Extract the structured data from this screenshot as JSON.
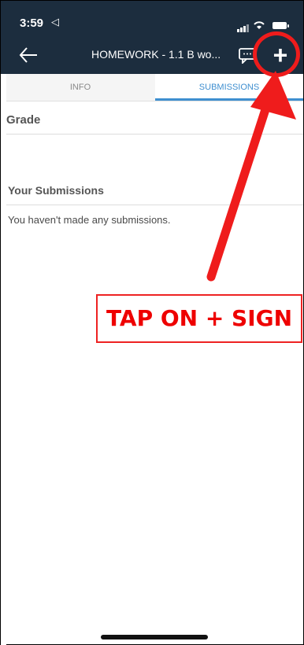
{
  "status_bar": {
    "time": "3:59",
    "location_glyph": "◁"
  },
  "nav": {
    "back_icon": "back-arrow-icon",
    "title": "HOMEWORK - 1.1 B wo...",
    "chat_icon": "chat-bubble-icon",
    "add_label": "+"
  },
  "tabs": [
    {
      "label": "INFO",
      "active": false
    },
    {
      "label": "SUBMISSIONS",
      "active": true
    }
  ],
  "grade": {
    "heading": "Grade"
  },
  "submissions": {
    "heading": "Your Submissions",
    "empty_message": "You haven't made any submissions."
  },
  "annotation": {
    "label": "TAP ON + SIGN",
    "color": "#ef1c1c"
  },
  "colors": {
    "topbar": "#1c2d3e",
    "accent": "#3f8fd0"
  }
}
